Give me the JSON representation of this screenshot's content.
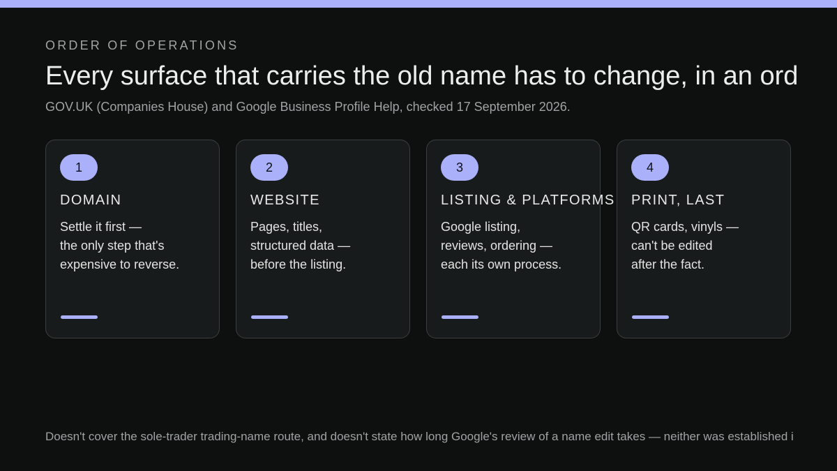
{
  "header": {
    "eyebrow": "ORDER OF OPERATIONS",
    "title": "Every surface that carries the old name has to change, in an ord",
    "source": "GOV.UK (Companies House) and Google Business Profile Help, checked 17 September 2026."
  },
  "steps": [
    {
      "number": "1",
      "title": "DOMAIN",
      "lines": [
        "Settle it first —",
        "the only step that's",
        "expensive to reverse."
      ]
    },
    {
      "number": "2",
      "title": "WEBSITE",
      "lines": [
        "Pages, titles,",
        "structured data —",
        "before the listing."
      ]
    },
    {
      "number": "3",
      "title": "LISTING & PLATFORMS",
      "lines": [
        "Google listing,",
        "reviews, ordering —",
        "each its own process."
      ]
    },
    {
      "number": "4",
      "title": "PRINT, LAST",
      "lines": [
        "QR cards, vinyls —",
        "can't be edited",
        "after the fact."
      ]
    }
  ],
  "footnote": "Doesn't cover the sole-trader trading-name route, and doesn't state how long Google's review of a name edit takes — neither was established i",
  "colors": {
    "accent": "#aab0fa",
    "background": "#0e0f0f",
    "card": "#181b1b",
    "card_border": "#3b3f3f"
  }
}
